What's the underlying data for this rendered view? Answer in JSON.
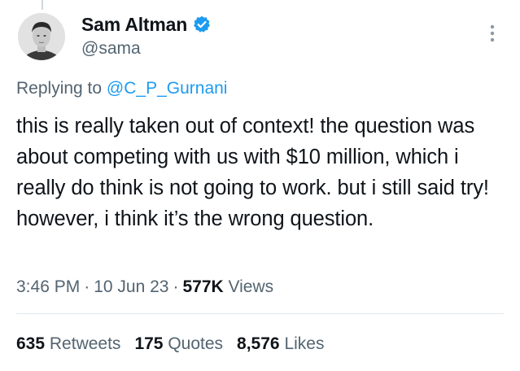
{
  "author": {
    "display_name": "Sam Altman",
    "handle": "@sama",
    "verified": true
  },
  "reply": {
    "prefix": "Replying to",
    "mention": "@C_P_Gurnani"
  },
  "tweet": {
    "text": "this is really taken out of context! the question was about competing with us with $10 million, which i really do think is not going to work. but i still said try! however, i think it’s the wrong question."
  },
  "meta": {
    "time": "3:46 PM",
    "date": "10 Jun 23",
    "views_count": "577K",
    "views_label": "Views",
    "separator": "·"
  },
  "stats": {
    "retweets_count": "635",
    "retweets_label": "Retweets",
    "quotes_count": "175",
    "quotes_label": "Quotes",
    "likes_count": "8,576",
    "likes_label": "Likes"
  },
  "icons": {
    "verified": "verified-badge-icon",
    "more": "more-options-icon"
  },
  "colors": {
    "accent": "#1d9bf0",
    "secondary_text": "#536471",
    "primary_text": "#0f1419"
  }
}
